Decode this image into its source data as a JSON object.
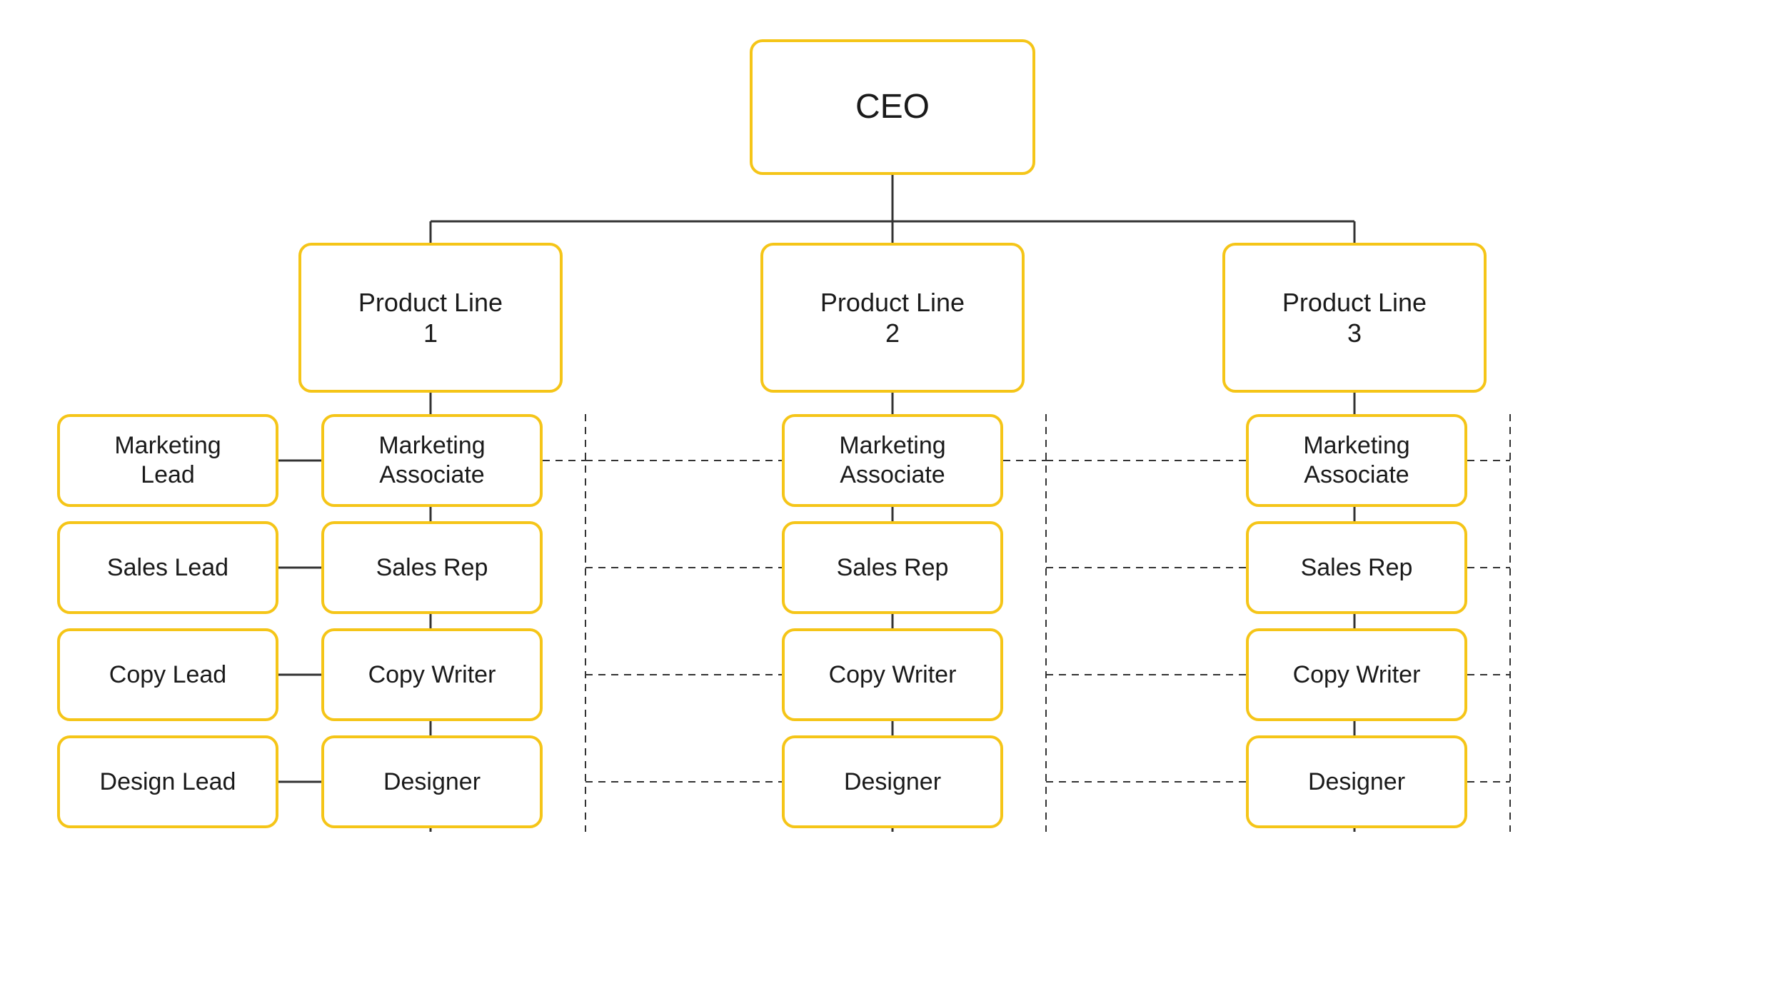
{
  "nodes": {
    "ceo": "CEO",
    "pl1": "Product Line\n1",
    "pl2": "Product Line\n2",
    "pl3": "Product Line\n3",
    "mkt_lead": "Marketing\nLead",
    "sales_lead": "Sales Lead",
    "copy_lead": "Copy Lead",
    "design_lead": "Design Lead",
    "pl1_mkta": "Marketing\nAssociate",
    "pl1_sales": "Sales Rep",
    "pl1_copy": "Copy Writer",
    "pl1_des": "Designer",
    "pl2_mkta": "Marketing\nAssociate",
    "pl2_sales": "Sales Rep",
    "pl2_copy": "Copy Writer",
    "pl2_des": "Designer",
    "pl3_mkta": "Marketing\nAssociate",
    "pl3_sales": "Sales Rep",
    "pl3_copy": "Copy Writer",
    "pl3_des": "Designer"
  },
  "colors": {
    "border": "#F5C518",
    "text": "#1a1a1a",
    "bg": "#ffffff"
  }
}
